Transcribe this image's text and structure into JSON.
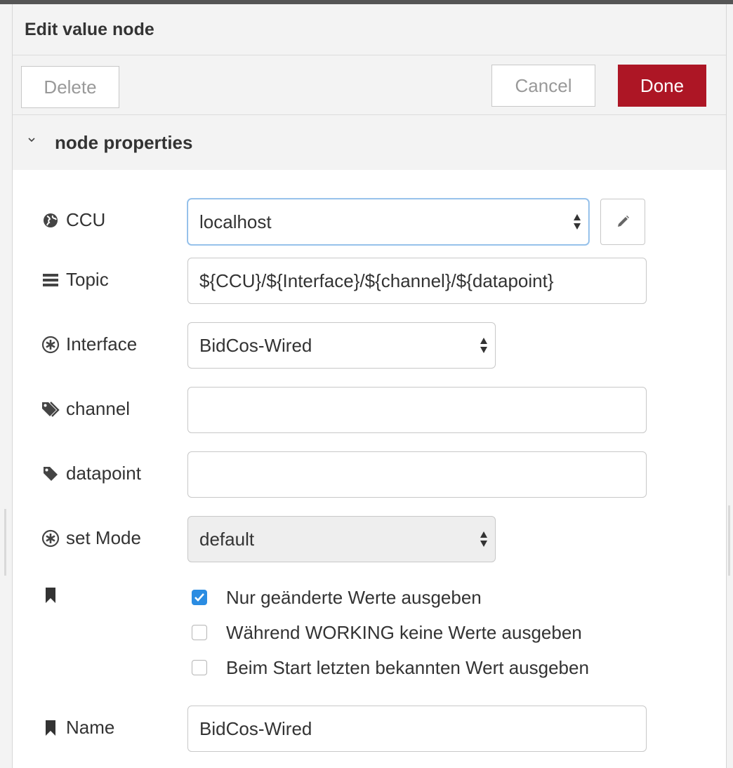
{
  "dialog": {
    "title": "Edit value node"
  },
  "toolbar": {
    "delete_label": "Delete",
    "cancel_label": "Cancel",
    "done_label": "Done",
    "done_color": "#ad1625"
  },
  "section": {
    "title": "node properties"
  },
  "fields": {
    "ccu": {
      "label": "CCU",
      "value": "localhost",
      "icon": "globe-icon"
    },
    "topic": {
      "label": "Topic",
      "value": "${CCU}/${Interface}/${channel}/${datapoint}",
      "icon": "list-icon"
    },
    "interface": {
      "label": "Interface",
      "value": "BidCos-Wired",
      "icon": "asterisk-circle-icon"
    },
    "channel": {
      "label": "channel",
      "value": "",
      "icon": "tags-icon"
    },
    "datapoint": {
      "label": "datapoint",
      "value": "",
      "icon": "tag-icon"
    },
    "set_mode": {
      "label": "set Mode",
      "value": "default",
      "icon": "asterisk-circle-icon"
    },
    "name": {
      "label": "Name",
      "value": "BidCos-Wired",
      "icon": "bookmark-icon"
    }
  },
  "options": [
    {
      "label": "Nur geänderte Werte ausgeben",
      "checked": true
    },
    {
      "label": "Während WORKING keine Werte ausgeben",
      "checked": false
    },
    {
      "label": "Beim Start letzten bekannten Wert ausgeben",
      "checked": false
    }
  ]
}
